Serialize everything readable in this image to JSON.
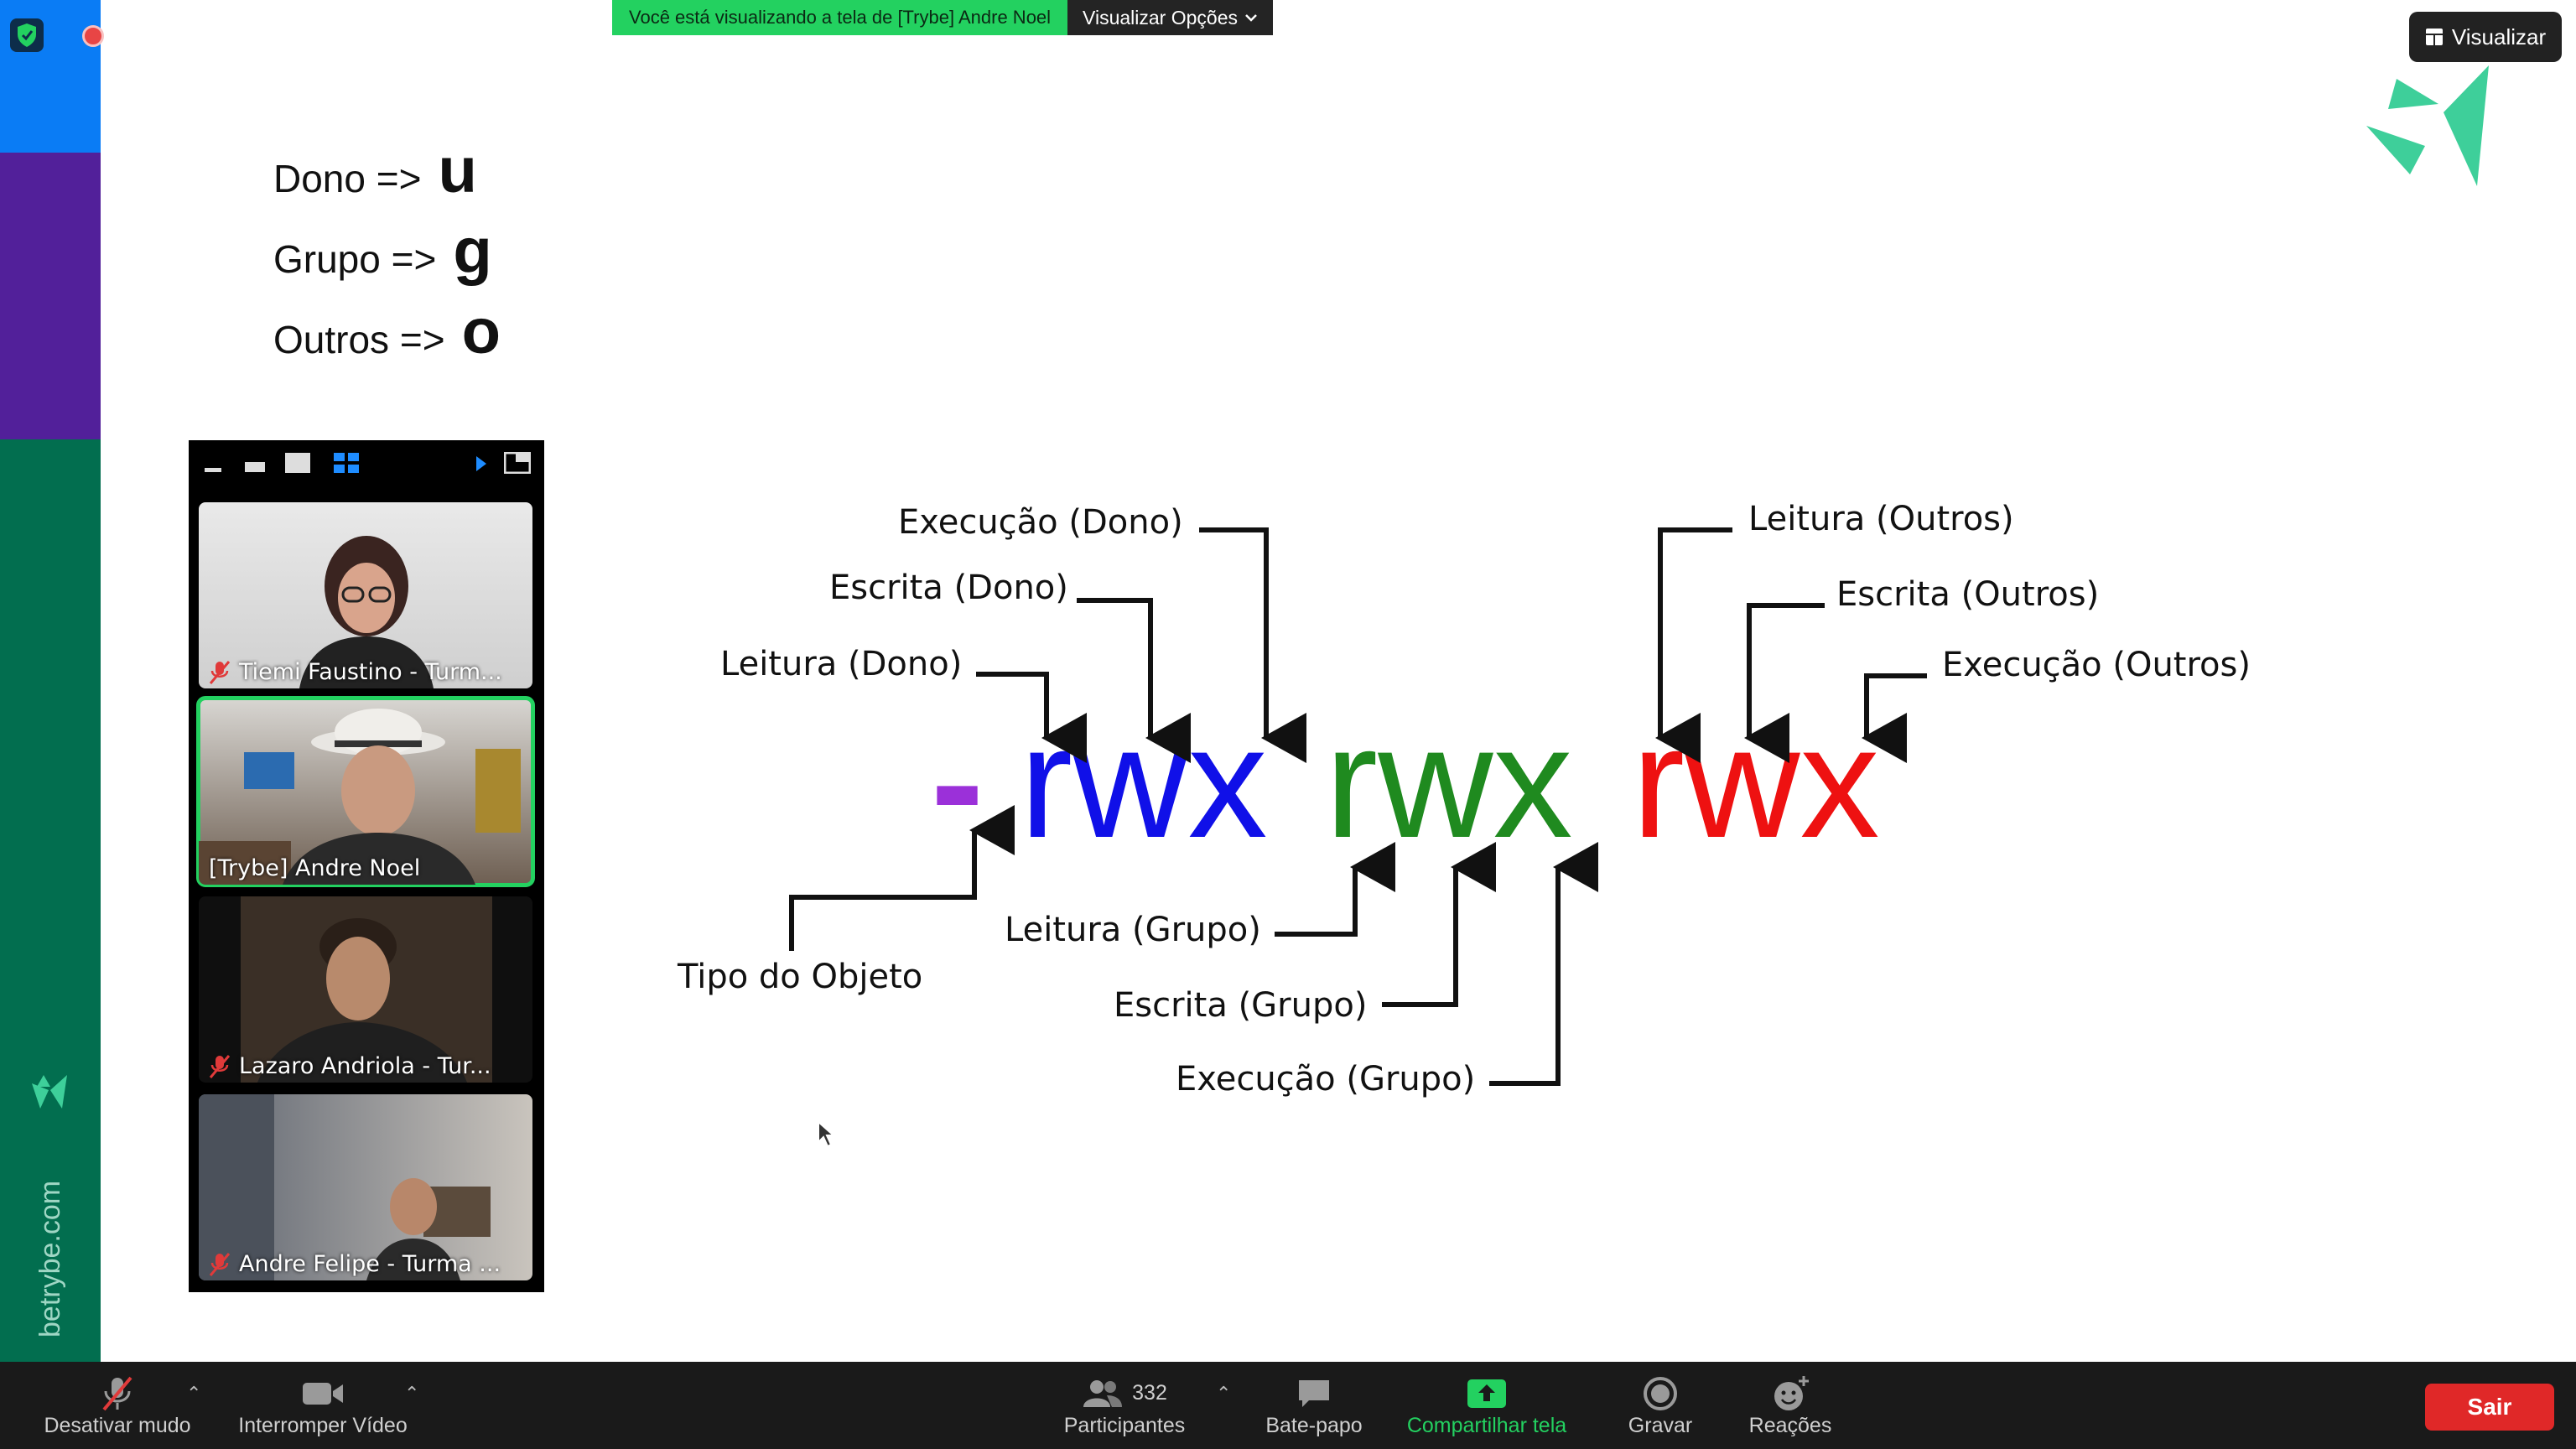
{
  "share_banner": {
    "text": "Você está visualizando a tela de [Trybe] Andre Noel",
    "options": "Visualizar Opções"
  },
  "view_button": {
    "label": "Visualizar"
  },
  "brand": {
    "url": "betrybe.com"
  },
  "legend": [
    {
      "label": "Dono =>",
      "letter": "u"
    },
    {
      "label": "Grupo =>",
      "letter": "g"
    },
    {
      "label": "Outros =>",
      "letter": "o"
    }
  ],
  "participants": [
    {
      "name": "Tiemi Faustino - Turm...",
      "muted": true,
      "active": false
    },
    {
      "name": "[Trybe] Andre Noel",
      "muted": false,
      "active": true
    },
    {
      "name": "Lazaro Andriola - Tur...",
      "muted": true,
      "active": false
    },
    {
      "name": "Andre Felipe - Turma ...",
      "muted": true,
      "active": false
    }
  ],
  "diagram": {
    "type_char": "-",
    "owner_perms": "rwx",
    "group_perms": "rwx",
    "others_perms": "rwx",
    "labels": {
      "exec_owner": "Execução (Dono)",
      "write_owner": "Escrita (Dono)",
      "read_owner": "Leitura (Dono)",
      "read_others": "Leitura (Outros)",
      "write_others": "Escrita (Outros)",
      "exec_others": "Execução (Outros)",
      "object_type": "Tipo do Objeto",
      "read_group": "Leitura (Grupo)",
      "write_group": "Escrita (Grupo)",
      "exec_group": "Execução (Grupo)"
    },
    "colors": {
      "type": "#9b30d9",
      "owner": "#1010e8",
      "group": "#1f8a1f",
      "others": "#ee1111"
    }
  },
  "toolbar": {
    "unmute": "Desativar mudo",
    "stop_video": "Interromper Vídeo",
    "participants": "Participantes",
    "participants_count": "332",
    "chat": "Bate-papo",
    "share_screen": "Compartilhar tela",
    "record": "Gravar",
    "reactions": "Reações",
    "leave": "Sair"
  }
}
